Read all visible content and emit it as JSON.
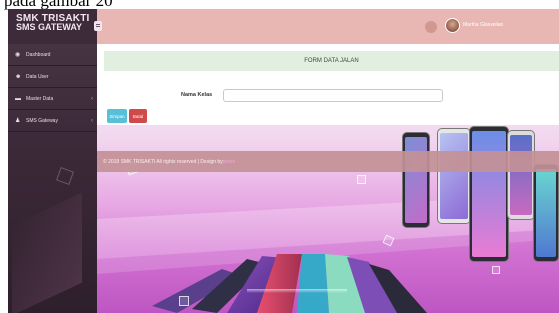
{
  "caption": "pada gambar 20",
  "brand": {
    "line1": "SMK TRISAKTI",
    "line2": "SMS GATEWAY"
  },
  "sidebar": {
    "items": [
      {
        "label": "Dashboard",
        "icon": "dashboard-icon",
        "has_submenu": false
      },
      {
        "label": "Data User",
        "icon": "users-icon",
        "has_submenu": false
      },
      {
        "label": "Master Data",
        "icon": "folder-icon",
        "has_submenu": true
      },
      {
        "label": "SMS Gateway",
        "icon": "user-icon",
        "has_submenu": true
      }
    ]
  },
  "topbar": {
    "user_name": "Martha Glasvelian"
  },
  "form": {
    "title": "FORM DATA JALAN",
    "field_label": "Nama Kelas",
    "field_value": "",
    "save_label": "Simpan",
    "cancel_label": "Batal"
  },
  "footer": {
    "text": "© 2018 SMK TRISAKTI All rights reserved | Design by ",
    "link": "press"
  },
  "colors": {
    "sidebar": "#3d2a3a",
    "topbar": "#e8b6b3",
    "form_title_bg": "#e0efdf",
    "save_button": "#57c0d8",
    "cancel_button": "#d04a4a",
    "footer": "#c39196"
  }
}
